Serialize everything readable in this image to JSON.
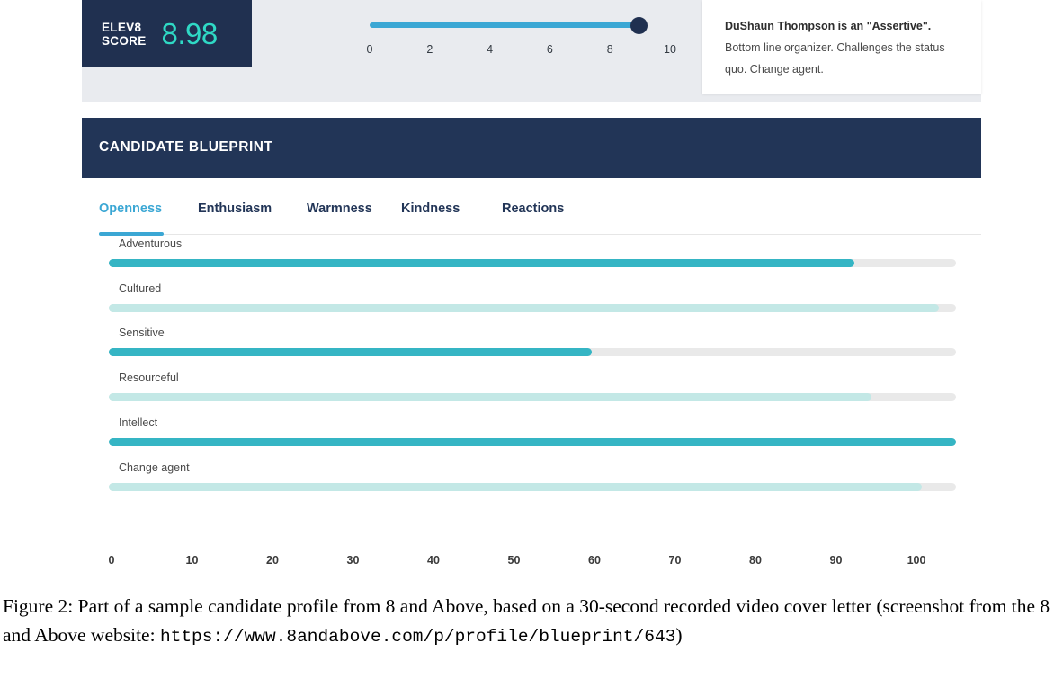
{
  "score_panel": {
    "label": "ELEV8\nSCORE",
    "value": "8.98",
    "slider": {
      "value": 8.98,
      "min": 0,
      "max": 10,
      "ticks": [
        "0",
        "2",
        "4",
        "6",
        "8",
        "10"
      ]
    }
  },
  "description": {
    "bold_part": "DuShaun Thompson is an \"Assertive\".",
    "rest": " Bottom line organizer. Challenges the status quo. Change agent."
  },
  "blueprint": {
    "title": "CANDIDATE BLUEPRINT",
    "tabs": [
      {
        "label": "Openness",
        "active": true
      },
      {
        "label": "Enthusiasm",
        "active": false
      },
      {
        "label": "Warmness",
        "active": false
      },
      {
        "label": "Kindness",
        "active": false
      },
      {
        "label": "Reactions",
        "active": false
      }
    ]
  },
  "colors": {
    "navy": "#223557",
    "score_navy": "#203050",
    "score_teal": "#2fd9c5",
    "slider_blue": "#3ba7d4",
    "bar_dark": "#35b5c4",
    "bar_light": "#c3e8e6",
    "bar_track": "#e9e9e9",
    "strip_grey": "#e9ebef"
  },
  "chart_data": {
    "type": "bar",
    "title": "Openness",
    "orientation": "horizontal",
    "categories": [
      "Adventurous",
      "Cultured",
      "Sensitive",
      "Resourceful",
      "Intellect",
      "Change agent"
    ],
    "values": [
      88,
      98,
      57,
      90,
      100,
      96
    ],
    "bar_colors": [
      "#35b5c4",
      "#c3e8e6",
      "#35b5c4",
      "#c3e8e6",
      "#35b5c4",
      "#c3e8e6"
    ],
    "xlabel": "",
    "ylabel": "",
    "xlim": [
      0,
      100
    ],
    "xticks": [
      "0",
      "10",
      "20",
      "30",
      "40",
      "50",
      "60",
      "70",
      "80",
      "90",
      "100"
    ],
    "grid": false,
    "legend": "none"
  },
  "caption": {
    "line1": "Figure 2: Part of a sample candidate profile from 8 and Above, based on a 30-second recorded video",
    "line2_pre": "cover letter (screenshot from the 8 and Above website: ",
    "url1": "https://www.8andabove.com/p/profile/",
    "url2": "blueprint/643",
    "line3_post": ")"
  }
}
